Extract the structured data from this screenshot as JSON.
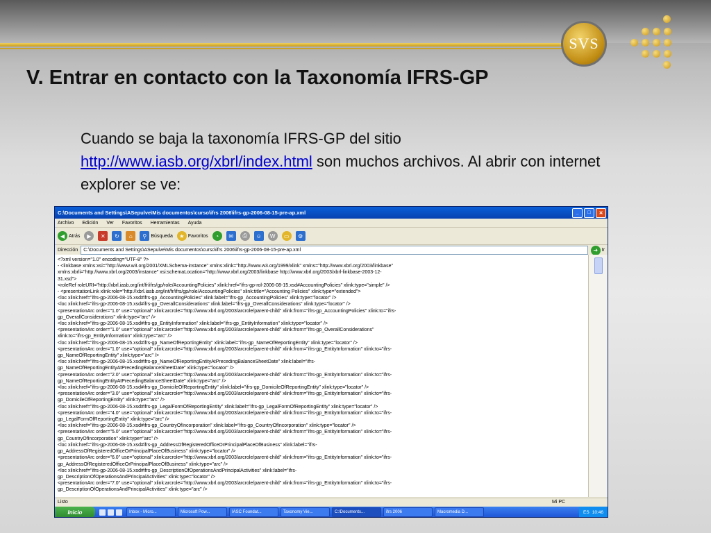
{
  "slide": {
    "logo_text": "SVS",
    "title": "V. Entrar en contacto con la Taxonomía IFRS-GP",
    "para_before": "Cuando  se baja la taxonomía IFRS-GP del sitio ",
    "link": "http://www.iasb.org/xbrl/index.html",
    "para_after": " son muchos archivos. Al abrir con internet explorer se ve:"
  },
  "browser": {
    "window_title": "C:\\Documents and Settings\\ASepulve\\Mis documentos\\curso\\ifrs 2006\\ifrs-gp-2006-08-15-pre-ap.xml",
    "menu": [
      "Archivo",
      "Edición",
      "Ver",
      "Favoritos",
      "Herramientas",
      "Ayuda"
    ],
    "toolbar": {
      "back": "Atrás",
      "search": "Búsqueda",
      "favorites": "Favoritos"
    },
    "address_label": "Dirección",
    "address_value": "C:\\Documents and Settings\\ASepulve\\Mis documentos\\curso\\ifrs 2006\\ifrs-gp-2006-08-15-pre-ap.xml",
    "go_label": "Ir",
    "xml_lines": [
      "<?xml version=\"1.0\" encoding=\"UTF-8\" ?>",
      "- <linkbase xmlns:xsi=\"http://www.w3.org/2001/XMLSchema-instance\" xmlns:xlink=\"http://www.w3.org/1999/xlink\" xmlns=\"http://www.xbrl.org/2003/linkbase\"",
      "    xmlns:xbrli=\"http://www.xbrl.org/2003/instance\" xsi:schemaLocation=\"http://www.xbrl.org/2003/linkbase http://www.xbrl.org/2003/xbrl-linkbase-2003-12-",
      "    31.xsd\">",
      "  <roleRef roleURI=\"http://xbrl.iasb.org/int/fr/ifrs/gp/role/AccountingPolicies\" xlink:href=\"ifrs-gp-rol-2006-08-15.xsd#AccountingPolicies\" xlink:type=\"simple\" />",
      "- <presentationLink xlink:role=\"http://xbrl.iasb.org/int/fr/ifrs/gp/role/AccountingPolicies\" xlink:title=\"Accounting Policies\" xlink:type=\"extended\">",
      "    <loc xlink:href=\"ifrs-gp-2006-08-15.xsd#ifrs-gp_AccountingPolicies\" xlink:label=\"ifrs-gp_AccountingPolicies\" xlink:type=\"locator\" />",
      "    <loc xlink:href=\"ifrs-gp-2006-08-15.xsd#ifrs-gp_OverallConsiderations\" xlink:label=\"ifrs-gp_OverallConsiderations\" xlink:type=\"locator\" />",
      "    <presentationArc order=\"1.0\" use=\"optional\" xlink:arcrole=\"http://www.xbrl.org/2003/arcrole/parent-child\" xlink:from=\"ifrs-gp_AccountingPolicies\" xlink:to=\"ifrs-",
      "      gp_OverallConsiderations\" xlink:type=\"arc\" />",
      "    <loc xlink:href=\"ifrs-gp-2006-08-15.xsd#ifrs-gp_EntityInformation\" xlink:label=\"ifrs-gp_EntityInformation\" xlink:type=\"locator\" />",
      "    <presentationArc order=\"1.0\" use=\"optional\" xlink:arcrole=\"http://www.xbrl.org/2003/arcrole/parent-child\" xlink:from=\"ifrs-gp_OverallConsiderations\"",
      "      xlink:to=\"ifrs-gp_EntityInformation\" xlink:type=\"arc\" />",
      "    <loc xlink:href=\"ifrs-gp-2006-08-15.xsd#ifrs-gp_NameOfReportingEntity\" xlink:label=\"ifrs-gp_NameOfReportingEntity\" xlink:type=\"locator\" />",
      "    <presentationArc order=\"1.0\" use=\"optional\" xlink:arcrole=\"http://www.xbrl.org/2003/arcrole/parent-child\" xlink:from=\"ifrs-gp_EntityInformation\" xlink:to=\"ifrs-",
      "      gp_NameOfReportingEntity\" xlink:type=\"arc\" />",
      "    <loc xlink:href=\"ifrs-gp-2006-08-15.xsd#ifrs-gp_NameOfReportingEntityAtPrecedingBalanceSheetDate\" xlink:label=\"ifrs-",
      "      gp_NameOfReportingEntityAtPrecedingBalanceSheetDate\" xlink:type=\"locator\" />",
      "    <presentationArc order=\"2.0\" use=\"optional\" xlink:arcrole=\"http://www.xbrl.org/2003/arcrole/parent-child\" xlink:from=\"ifrs-gp_EntityInformation\" xlink:to=\"ifrs-",
      "      gp_NameOfReportingEntityAtPrecedingBalanceSheetDate\" xlink:type=\"arc\" />",
      "    <loc xlink:href=\"ifrs-gp-2006-08-15.xsd#ifrs-gp_DomicileOfReportingEntity\" xlink:label=\"ifrs-gp_DomicileOfReportingEntity\" xlink:type=\"locator\" />",
      "    <presentationArc order=\"3.0\" use=\"optional\" xlink:arcrole=\"http://www.xbrl.org/2003/arcrole/parent-child\" xlink:from=\"ifrs-gp_EntityInformation\" xlink:to=\"ifrs-",
      "      gp_DomicileOfReportingEntity\" xlink:type=\"arc\" />",
      "    <loc xlink:href=\"ifrs-gp-2006-08-15.xsd#ifrs-gp_LegalFormOfReportingEntity\" xlink:label=\"ifrs-gp_LegalFormOfReportingEntity\" xlink:type=\"locator\" />",
      "    <presentationArc order=\"4.0\" use=\"optional\" xlink:arcrole=\"http://www.xbrl.org/2003/arcrole/parent-child\" xlink:from=\"ifrs-gp_EntityInformation\" xlink:to=\"ifrs-",
      "      gp_LegalFormOfReportingEntity\" xlink:type=\"arc\" />",
      "    <loc xlink:href=\"ifrs-gp-2006-08-15.xsd#ifrs-gp_CountryOfIncorporation\" xlink:label=\"ifrs-gp_CountryOfIncorporation\" xlink:type=\"locator\" />",
      "    <presentationArc order=\"5.0\" use=\"optional\" xlink:arcrole=\"http://www.xbrl.org/2003/arcrole/parent-child\" xlink:from=\"ifrs-gp_EntityInformation\" xlink:to=\"ifrs-",
      "      gp_CountryOfIncorporation\" xlink:type=\"arc\" />",
      "    <loc xlink:href=\"ifrs-gp-2006-08-15.xsd#ifrs-gp_AddressOfRegisteredOfficeOrPrincipalPlaceOfBusiness\" xlink:label=\"ifrs-",
      "      gp_AddressOfRegisteredOfficeOrPrincipalPlaceOfBusiness\" xlink:type=\"locator\" />",
      "    <presentationArc order=\"6.0\" use=\"optional\" xlink:arcrole=\"http://www.xbrl.org/2003/arcrole/parent-child\" xlink:from=\"ifrs-gp_EntityInformation\" xlink:to=\"ifrs-",
      "      gp_AddressOfRegisteredOfficeOrPrincipalPlaceOfBusiness\" xlink:type=\"arc\" />",
      "    <loc xlink:href=\"ifrs-gp-2006-08-15.xsd#ifrs-gp_DescriptionOfOperationsAndPrincipalActivities\" xlink:label=\"ifrs-",
      "      gp_DescriptionOfOperationsAndPrincipalActivities\" xlink:type=\"locator\" />",
      "    <presentationArc order=\"7.0\" use=\"optional\" xlink:arcrole=\"http://www.xbrl.org/2003/arcrole/parent-child\" xlink:from=\"ifrs-gp_EntityInformation\" xlink:to=\"ifrs-",
      "      gp_DescriptionOfOperationsAndPrincipalActivities\" xlink:type=\"arc\" />"
    ],
    "status_left": "Listo",
    "status_right": "Mi PC"
  },
  "taskbar": {
    "start": "Inicio",
    "tasks": [
      "Inbox - Micro...",
      "Microsoft Pow...",
      "IASC Foundat...",
      "Taxonomy Vie...",
      "C:\\Documents...",
      "ifrs 2006",
      "Macromedia D..."
    ],
    "active_task_index": 4,
    "lang": "ES",
    "clock": "10:46"
  },
  "colors": {
    "accent_gold": "#c9a227",
    "xp_blue": "#1f54d6"
  }
}
